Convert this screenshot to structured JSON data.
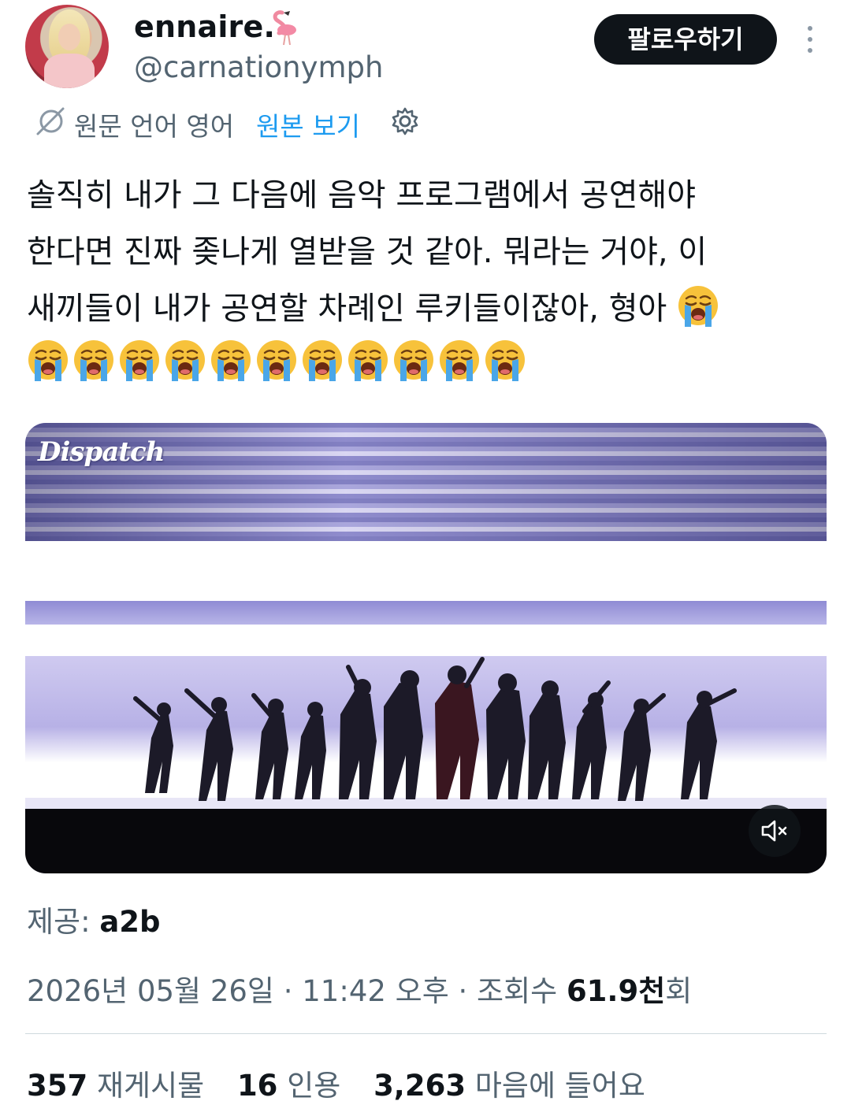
{
  "author": {
    "display_name": "ennaire.",
    "name_emoji": "flamingo-icon",
    "handle": "@carnationymph"
  },
  "header": {
    "follow_label": "팔로우하기",
    "more_icon": "more-vertical-icon"
  },
  "translation": {
    "label": "원문 언어 영어",
    "view_original": "원본 보기",
    "icon": "translate-off-icon",
    "settings_icon": "gear-icon"
  },
  "tweet": {
    "lines": [
      "솔직히 내가 그 다음에 음악 프로그램에서 공연해야",
      "한다면 진짜 좆나게 열받을 것 같아. 뭐라는 거야, 이",
      "새끼들이 내가 공연할 차례인 루키들이잖아, 형아"
    ],
    "emoji": "loudly-crying-face-icon",
    "emoji_count_inline": 1,
    "emoji_count_row": 11
  },
  "media": {
    "watermark": "Dispatch",
    "mute_icon": "speaker-muted-icon"
  },
  "provider": {
    "label": "제공:",
    "name": "a2b"
  },
  "meta": {
    "date": "2026년 05월 26일",
    "separator": "·",
    "time": "11:42 오후",
    "views_label": "조회수",
    "views_number": "61.9",
    "views_unit": "천",
    "views_suffix": "회"
  },
  "stats": {
    "retweets_count": "357",
    "retweets_label": "재게시물",
    "quotes_count": "16",
    "quotes_label": "인용",
    "likes_count": "3,263",
    "likes_label": "마음에 들어요"
  },
  "colors": {
    "text": "#0f1419",
    "secondary": "#536471",
    "link": "#1d9bf0",
    "follow_bg": "#0f1419"
  }
}
